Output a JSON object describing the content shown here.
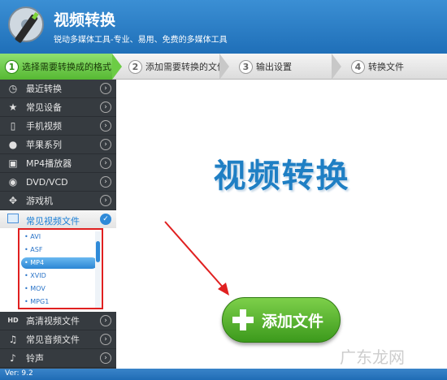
{
  "app": {
    "title": "视频转换",
    "subtitle": "锐动多媒体工具-专业、易用、免费的多媒体工具"
  },
  "steps": [
    {
      "num": "1",
      "label": "选择需要转换成的格式",
      "active": true
    },
    {
      "num": "2",
      "label": "添加需要转换的文件",
      "active": false
    },
    {
      "num": "3",
      "label": "输出设置",
      "active": false
    },
    {
      "num": "4",
      "label": "转换文件",
      "active": false
    }
  ],
  "sidebar": {
    "items_top": [
      {
        "label": "最近转换",
        "icon": "clock-icon"
      },
      {
        "label": "常见设备",
        "icon": "star-icon"
      },
      {
        "label": "手机视频",
        "icon": "phone-icon"
      },
      {
        "label": "苹果系列",
        "icon": "apple-icon"
      },
      {
        "label": "MP4播放器",
        "icon": "mp4-player-icon"
      },
      {
        "label": "DVD/VCD",
        "icon": "disc-icon"
      },
      {
        "label": "游戏机",
        "icon": "gamepad-icon"
      }
    ],
    "open_category": {
      "label": "常见视频文件",
      "formats": [
        "AVI",
        "ASF",
        "MP4",
        "XVID",
        "MOV",
        "MPG1"
      ],
      "selected": "MP4"
    },
    "items_bottom": [
      {
        "label": "高清视频文件",
        "icon": "hd-icon"
      },
      {
        "label": "常见音频文件",
        "icon": "music-note-icon"
      },
      {
        "label": "铃声",
        "icon": "bell-icon"
      }
    ]
  },
  "main": {
    "big_title": "视频转换",
    "add_button": "添加文件"
  },
  "footer": {
    "version": "Ver: 9.2"
  },
  "watermark": "广东龙网",
  "colors": {
    "header": "#2a7fc9",
    "active_step": "#6ccc45",
    "sidebar": "#363b40",
    "add_button": "#4fae2a",
    "title": "#1f7fc4",
    "annotation": "#e02020"
  }
}
